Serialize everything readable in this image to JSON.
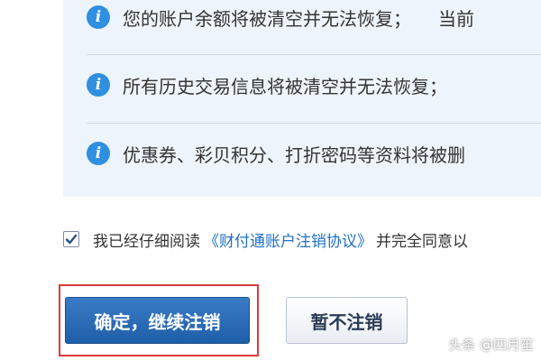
{
  "notices": {
    "item1": {
      "text": "您的账户余额将被清空并无法恢复；",
      "tail": "当前",
      "icon": "info-icon"
    },
    "item2": {
      "text": "所有历史交易信息将被清空并无法恢复；",
      "icon": "info-icon"
    },
    "item3": {
      "text": "优惠券、彩贝积分、打折密码等资料将被删",
      "icon": "info-icon"
    }
  },
  "agreement": {
    "checked": true,
    "prefix": "我已经仔细阅读",
    "link": "《财付通账户注销协议》",
    "suffix": "并完全同意以"
  },
  "buttons": {
    "confirm_label": "确定，继续注销",
    "cancel_label": "暂不注销"
  },
  "watermark": "头条 @四月笙",
  "colors": {
    "accent": "#1f5fa8",
    "link": "#1f6fc5",
    "highlight": "#e03a3a",
    "panel_bg": "#eef4fb"
  }
}
